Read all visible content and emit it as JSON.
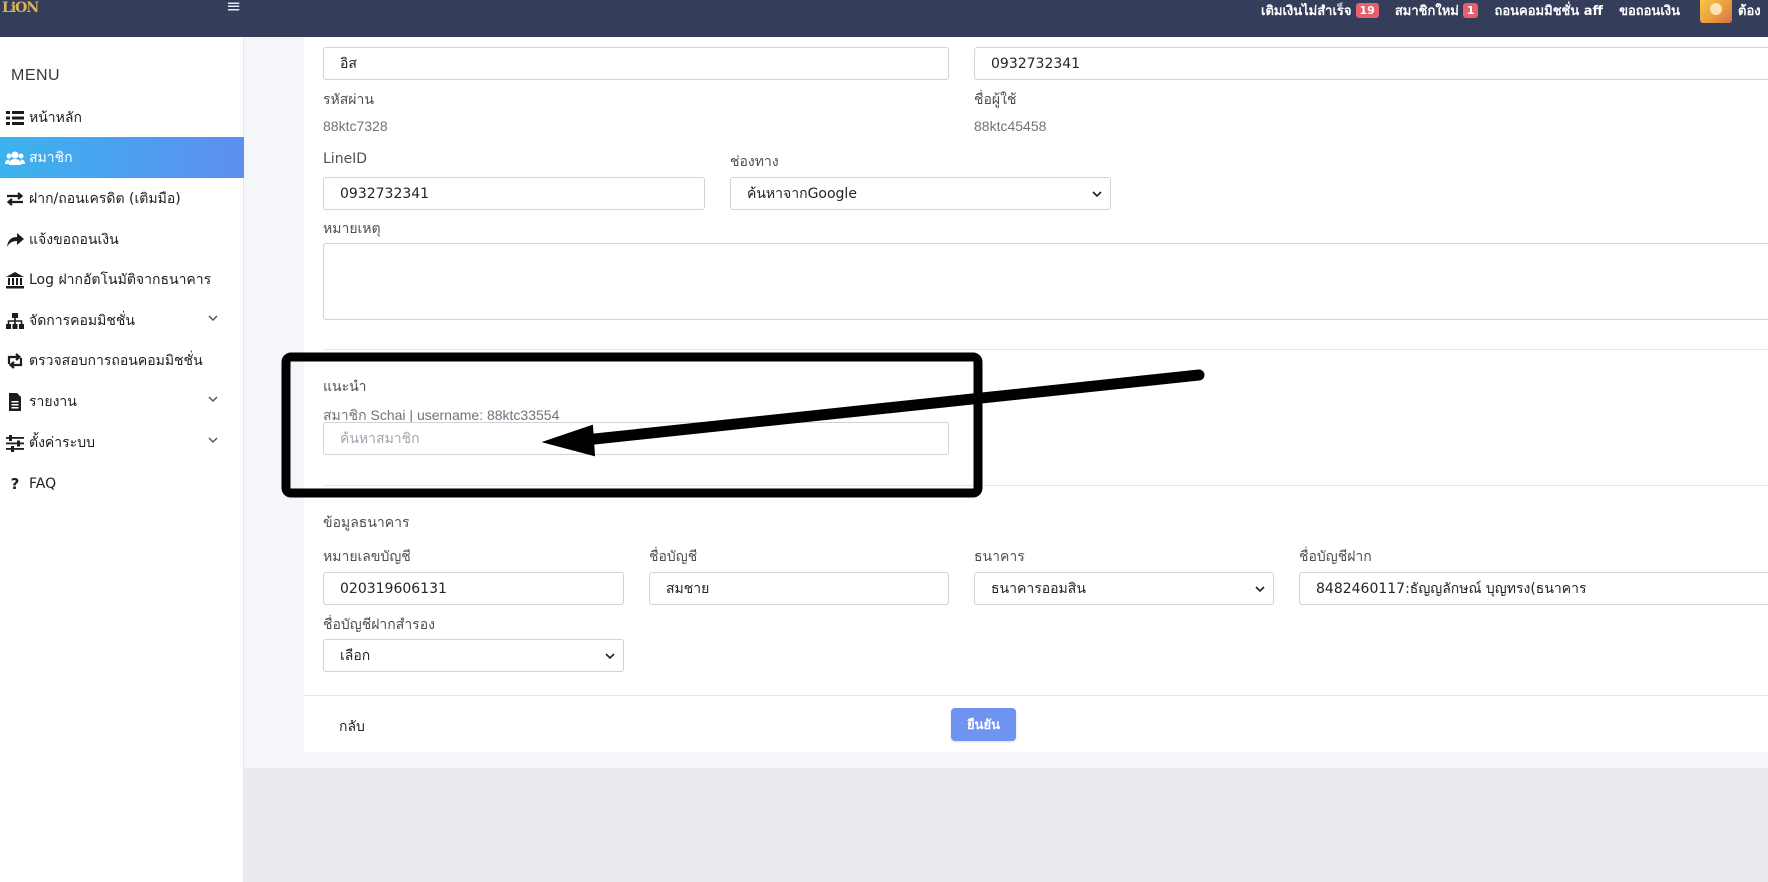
{
  "navbar": {
    "logo_text": "LiON",
    "links": [
      {
        "label": "เติมเงินไม่สำเร็จ",
        "badge": "19"
      },
      {
        "label": "สมาชิกใหม่",
        "badge": "1"
      },
      {
        "label": "ถอนคอมมิชชั่น aff",
        "badge": ""
      },
      {
        "label": "ขอถอนเงิน",
        "badge": ""
      }
    ],
    "user_name": "ต้อง"
  },
  "sidebar": {
    "title": "MENU",
    "items": [
      {
        "label": "หน้าหลัก",
        "icon": "list-icon",
        "active": false,
        "has_chevron": false
      },
      {
        "label": "สมาชิก",
        "icon": "users-icon",
        "active": true,
        "has_chevron": false
      },
      {
        "label": "ฝาก/ถอนเครดิต (เติมมือ)",
        "icon": "exchange-icon",
        "active": false,
        "has_chevron": false
      },
      {
        "label": "แจ้งขอถอนเงิน",
        "icon": "share-icon",
        "active": false,
        "has_chevron": false
      },
      {
        "label": "Log ฝากอัตโนมัติจากธนาคาร",
        "icon": "bank-icon",
        "active": false,
        "has_chevron": false
      },
      {
        "label": "จัดการคอมมิชชั่น",
        "icon": "sitemap-icon",
        "active": false,
        "has_chevron": true
      },
      {
        "label": "ตรวจสอบการถอนคอมมิชชั่น",
        "icon": "retweet-icon",
        "active": false,
        "has_chevron": false
      },
      {
        "label": "รายงาน",
        "icon": "document-icon",
        "active": false,
        "has_chevron": true
      },
      {
        "label": "ตั้งค่าระบบ",
        "icon": "sliders-icon",
        "active": false,
        "has_chevron": true
      },
      {
        "label": "FAQ",
        "icon": "question-icon",
        "active": false,
        "has_chevron": false
      }
    ]
  },
  "form": {
    "lastname_value": "อิส",
    "phone_value": "0932732341",
    "password_label": "รหัสผ่าน",
    "password_value": "88ktc7328",
    "username_label": "ชื่อผู้ใช้",
    "username_value": "88ktc45458",
    "lineid_label": "LineID",
    "lineid_value": "0932732341",
    "channel_label": "ช่องทาง",
    "channel_value": "ค้นหาจากGoogle",
    "note_label": "หมายเหตุ",
    "note_value": "",
    "referral_label": "แนะนำ",
    "referral_info": "สมาชิก Schai | username: 88ktc33554",
    "referral_placeholder": "ค้นหาสมาชิก",
    "bank_section_label": "ข้อมูลธนาคาร",
    "account_number_label": "หมายเลขบัญชี",
    "account_number_value": "020319606131",
    "account_name_label": "ชื่อบัญชี",
    "account_name_value": "สมชาย",
    "bank_label": "ธนาคาร",
    "bank_value": "ธนาคารออมสิน",
    "deposit_account_label": "ชื่อบัญชีฝาก",
    "deposit_account_value": "8482460117:ธัญญลักษณ์ บุญทรง(ธนาคาร",
    "backup_account_label": "ชื่อบัญชีฝากสำรอง",
    "backup_account_value": "เลือก",
    "back_label": "กลับ",
    "confirm_label": "ยืนยัน"
  },
  "colors": {
    "navbar_bg": "#343e5b",
    "active_gradient_start": "#3bb3ee",
    "active_gradient_end": "#5d8ef0",
    "confirm_button": "#6f93f1",
    "badge_red": "#e4606d"
  }
}
